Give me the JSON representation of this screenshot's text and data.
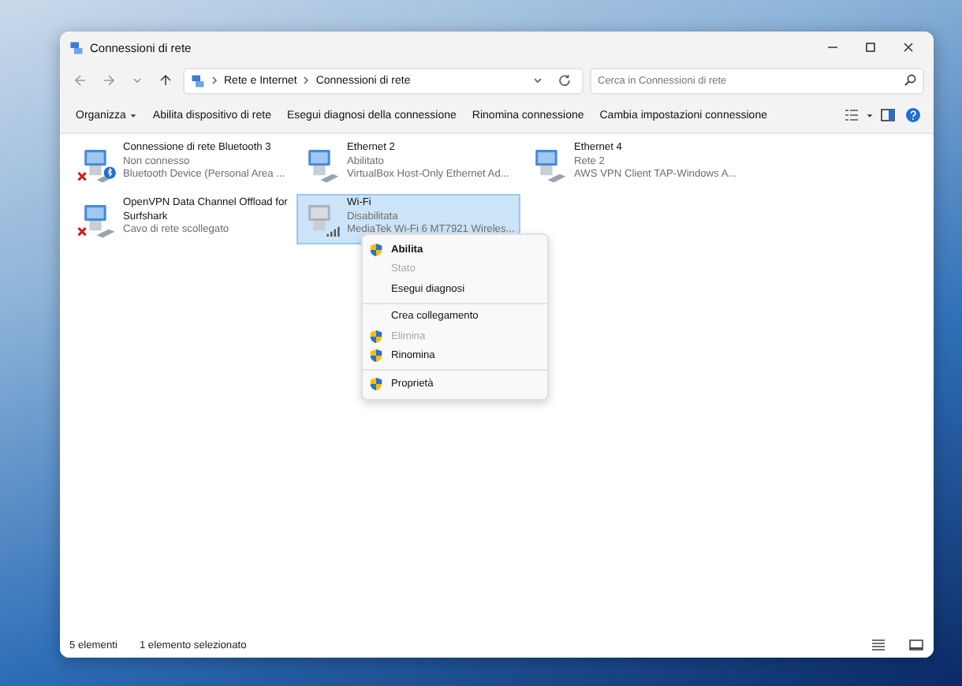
{
  "window": {
    "title": "Connessioni di rete"
  },
  "address": {
    "breadcrumbs": [
      {
        "label": "Rete e Internet"
      },
      {
        "label": "Connessioni di rete"
      }
    ],
    "search": {
      "placeholder": "Cerca in Connessioni di rete"
    }
  },
  "commands": [
    {
      "label": "Organizza",
      "dropdown": true
    },
    {
      "label": "Abilita dispositivo di rete",
      "dropdown": false
    },
    {
      "label": "Esegui diagnosi della connessione",
      "dropdown": false
    },
    {
      "label": "Rinomina connessione",
      "dropdown": false
    },
    {
      "label": "Cambia impostazioni connessione",
      "dropdown": false
    }
  ],
  "connections": [
    {
      "name": "Connessione di rete Bluetooth 3",
      "status": "Non connesso",
      "device": "Bluetooth Device (Personal Area ...",
      "kind": "bluetooth",
      "disconnected": true,
      "selected": false
    },
    {
      "name": "Ethernet 2",
      "status": "Abilitato",
      "device": "VirtualBox Host-Only Ethernet Ad...",
      "kind": "ethernet",
      "disconnected": false,
      "selected": false
    },
    {
      "name": "Ethernet 4",
      "status": "Rete 2",
      "device": "AWS VPN Client TAP-Windows A...",
      "kind": "ethernet",
      "disconnected": false,
      "selected": false
    },
    {
      "name": "OpenVPN Data Channel Offload for Surfshark",
      "status": "Cavo di rete scollegato",
      "kind": "ethernet",
      "disconnected": true,
      "selected": false
    },
    {
      "name": "Wi-Fi",
      "status": "Disabilitata",
      "device": "MediaTek Wi-Fi 6 MT7921 Wireles...",
      "kind": "wifi",
      "disconnected": false,
      "selected": true
    }
  ],
  "context_menu": {
    "groups": [
      [
        {
          "label": "Abilita",
          "shield": true,
          "disabled": false,
          "default": true
        },
        {
          "label": "Stato",
          "shield": false,
          "disabled": true,
          "default": false
        },
        {
          "label": "Esegui diagnosi",
          "shield": false,
          "disabled": false,
          "default": false
        }
      ],
      [
        {
          "label": "Crea collegamento",
          "shield": false,
          "disabled": false,
          "default": false
        },
        {
          "label": "Elimina",
          "shield": true,
          "disabled": true,
          "default": false
        },
        {
          "label": "Rinomina",
          "shield": true,
          "disabled": false,
          "default": false
        }
      ],
      [
        {
          "label": "Proprietà",
          "shield": true,
          "disabled": false,
          "default": false
        }
      ]
    ]
  },
  "status_bar": {
    "count": "5 elementi",
    "selection": "1 elemento selezionato"
  }
}
